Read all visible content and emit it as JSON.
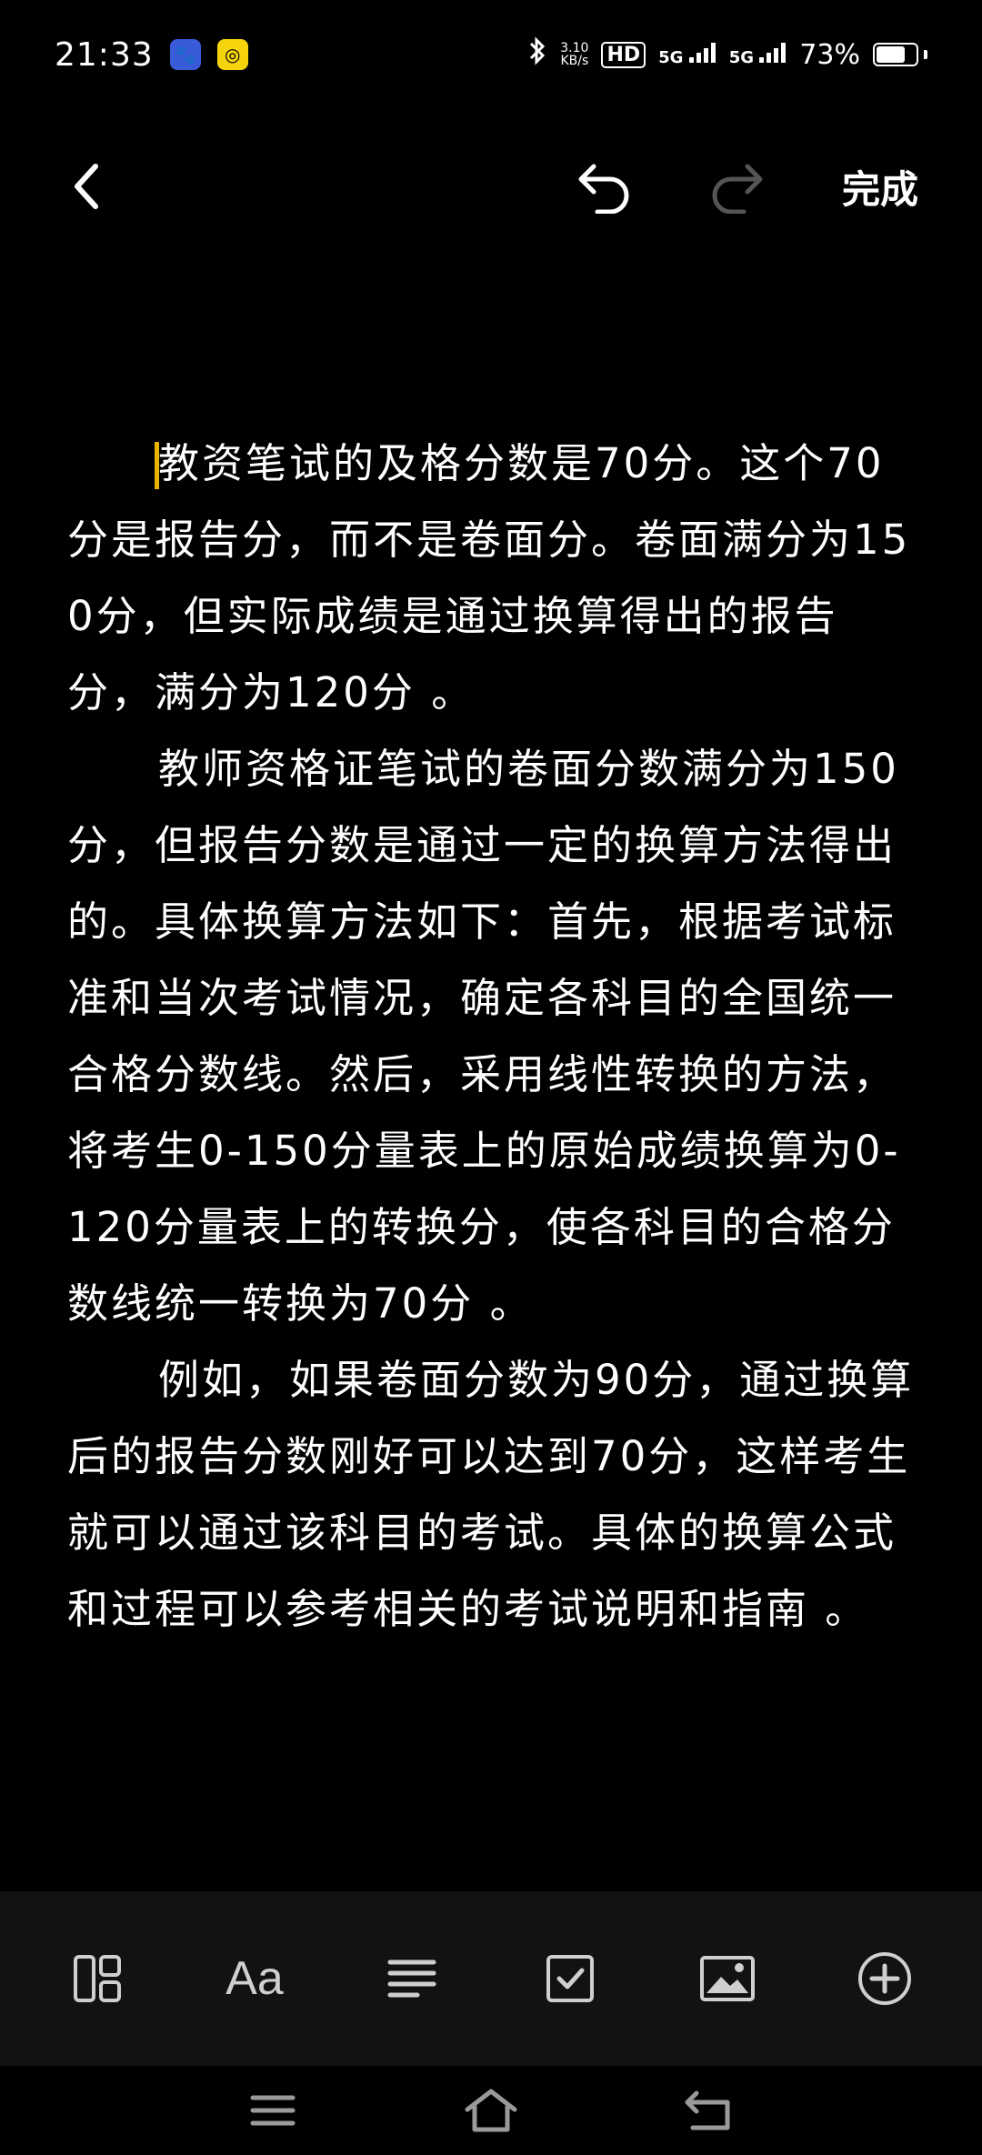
{
  "status_bar": {
    "time": "21:33",
    "net_speed_value": "3.10",
    "net_speed_unit": "KB/s",
    "hd_label": "HD",
    "signal1_label": "5G",
    "signal2_label": "5G",
    "battery_percent": "73%",
    "battery_level": 0.73
  },
  "toolbar": {
    "done_label": "完成"
  },
  "note": {
    "paragraphs": [
      "教资笔试的及格分数是70分。这个70分是报告分，而不是卷面分。卷面满分为150分，但实际成绩是通过换算得出的报告分，满分为120分 。",
      "教师资格证笔试的卷面分数满分为150分，但报告分数是通过一定的换算方法得出的。具体换算方法如下：首先，根据考试标准和当次考试情况，确定各科目的全国统一合格分数线。然后，采用线性转换的方法，将考生0-150分量表上的原始成绩换算为0-120分量表上的转换分，使各科目的合格分数线统一转换为70分 。",
      "例如，如果卷面分数为90分，通过换算后的报告分数刚好可以达到70分，这样考生就可以通过该科目的考试。具体的换算公式和过程可以参考相关的考试说明和指南 。"
    ]
  },
  "format_bar": {
    "text_style_label": "Aa"
  },
  "icons": {
    "back": "chevron-left-icon",
    "undo": "undo-icon",
    "redo": "redo-icon",
    "layout": "layout-icon",
    "align": "align-left-icon",
    "checklist": "checkbox-icon",
    "image": "image-icon",
    "add": "plus-circle-icon"
  },
  "colors": {
    "background": "#000000",
    "caret": "#e9b500",
    "toolbar_bg": "#121212",
    "redo_disabled": "#555555"
  }
}
